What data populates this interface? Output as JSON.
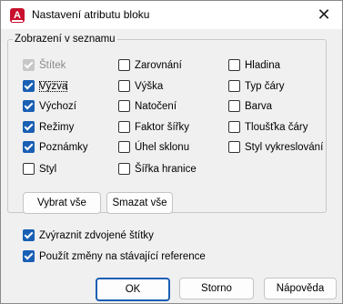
{
  "window": {
    "title": "Nastavení atributu bloku",
    "close_glyph": "✕",
    "app_icon_letter": "A"
  },
  "group": {
    "legend": "Zobrazení v seznamu",
    "checkboxes": [
      {
        "label": "Štítek",
        "checked": true,
        "disabled": true
      },
      {
        "label": "Výzva",
        "checked": true
      },
      {
        "label": "Výchozí",
        "checked": true
      },
      {
        "label": "Režimy",
        "checked": true
      },
      {
        "label": "Poznámky",
        "checked": true
      },
      {
        "label": "Styl",
        "checked": false
      },
      {
        "label": "Zarovnání",
        "checked": false
      },
      {
        "label": "Výška",
        "checked": false
      },
      {
        "label": "Natočení",
        "checked": false
      },
      {
        "label": "Faktor šířky",
        "checked": false
      },
      {
        "label": "Úhel sklonu",
        "checked": false
      },
      {
        "label": "Šířka hranice",
        "checked": false
      },
      {
        "label": "Hladina",
        "checked": false
      },
      {
        "label": "Typ čáry",
        "checked": false
      },
      {
        "label": "Barva",
        "checked": false
      },
      {
        "label": "Tloušťka čáry",
        "checked": false
      },
      {
        "label": "Styl vykreslování",
        "checked": false
      }
    ],
    "select_all_label": "Vybrat vše",
    "clear_all_label": "Smazat vše"
  },
  "options": {
    "highlight_duplicates": {
      "label": "Zvýraznit zdvojené štítky",
      "checked": true
    },
    "apply_changes": {
      "label": "Použít změny na stávající reference",
      "checked": true
    }
  },
  "buttons": {
    "ok": "OK",
    "cancel": "Storno",
    "help": "Nápověda"
  },
  "colors": {
    "accent": "#1a5fb4",
    "app_icon": "#c8102e"
  }
}
